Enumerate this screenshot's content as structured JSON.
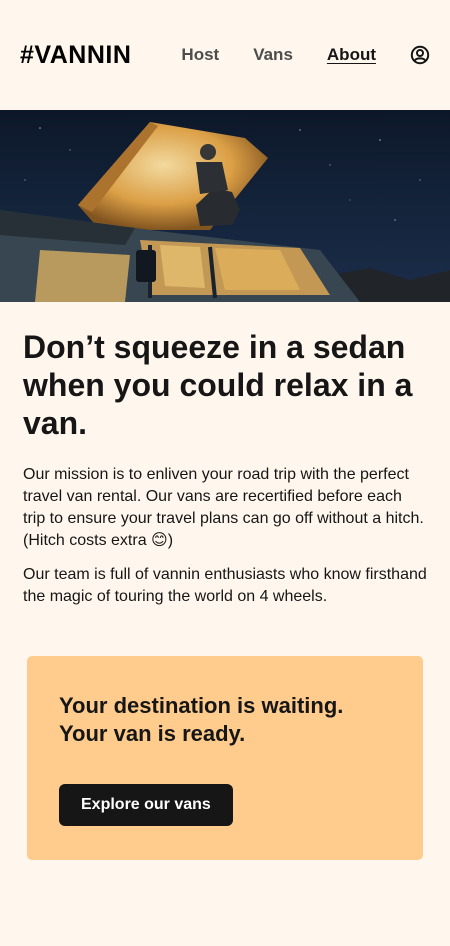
{
  "header": {
    "logo": "#VANNIN",
    "nav": [
      {
        "label": "Host"
      },
      {
        "label": "Vans"
      },
      {
        "label": "About",
        "active": true
      }
    ],
    "profile_icon": "user-circle-icon"
  },
  "hero": {
    "image": "night camper van with man sitting on pop-up roof"
  },
  "main": {
    "headline": "Don’t squeeze in a sedan when you could relax in a van.",
    "paragraph1": "Our mission is to enliven your road trip with the perfect travel van rental. Our vans are recertified before each trip to ensure your travel plans can go off without a hitch. (Hitch costs extra 😊)",
    "paragraph2": "Our team is full of vannin enthusiasts who know firsthand the magic of touring the world on 4 wheels."
  },
  "cta": {
    "title_line1": "Your destination is waiting.",
    "title_line2": "Your van is ready.",
    "button": "Explore our vans"
  },
  "colors": {
    "background": "#FFF7ED",
    "cta_background": "#FFCC8D",
    "button": "#161616"
  }
}
